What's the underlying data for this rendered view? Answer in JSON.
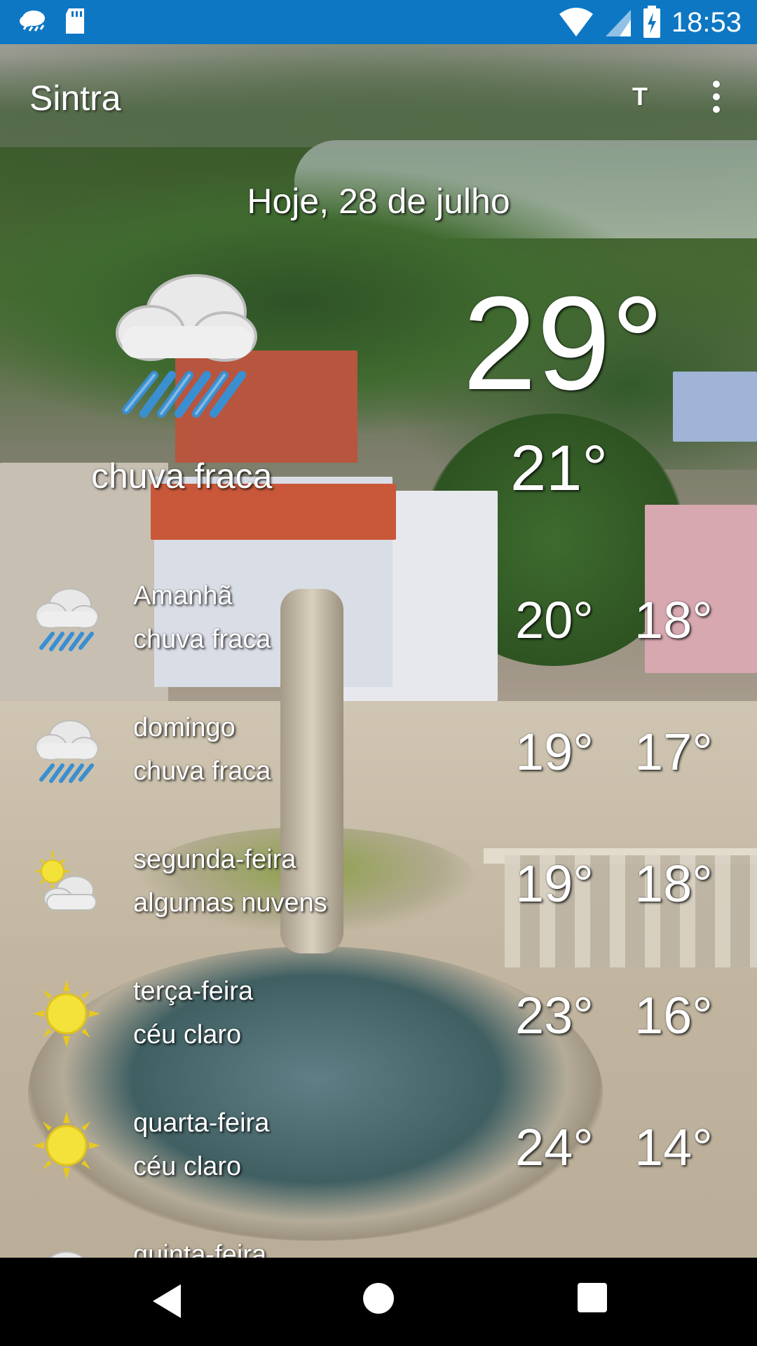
{
  "status_bar": {
    "time": "18:53",
    "icons": [
      "weather-rain-icon",
      "sd-card-icon",
      "wifi-icon",
      "cell-signal-icon",
      "battery-charging-icon"
    ]
  },
  "app_bar": {
    "title": "Sintra",
    "units_toggle": "T",
    "menu_icon": "overflow-menu-icon"
  },
  "current": {
    "date": "Hoje, 28 de julho",
    "temp": "29°",
    "low": "21°",
    "condition": "chuva fraca",
    "icon": "cloud-rain-icon"
  },
  "forecast": [
    {
      "name": "Amanhã",
      "condition": "chuva fraca",
      "hi": "20°",
      "lo": "18°",
      "icon": "cloud-rain-icon"
    },
    {
      "name": "domingo",
      "condition": "chuva fraca",
      "hi": "19°",
      "lo": "17°",
      "icon": "cloud-rain-icon"
    },
    {
      "name": "segunda-feira",
      "condition": "algumas nuvens",
      "hi": "19°",
      "lo": "18°",
      "icon": "sun-cloud-icon"
    },
    {
      "name": "terça-feira",
      "condition": "céu claro",
      "hi": "23°",
      "lo": "16°",
      "icon": "sun-icon"
    },
    {
      "name": "quarta-feira",
      "condition": "céu claro",
      "hi": "24°",
      "lo": "14°",
      "icon": "sun-icon"
    },
    {
      "name": "quinta-feira",
      "condition": "",
      "hi": "",
      "lo": "",
      "icon": "cloud-icon"
    }
  ],
  "nav_bar": {
    "icons": [
      "back-icon",
      "home-icon",
      "recents-icon"
    ]
  },
  "colors": {
    "status_bar": "#0d77c4",
    "text": "#ffffff",
    "sun": "#f2e23a",
    "rain": "#3a8fd1"
  }
}
